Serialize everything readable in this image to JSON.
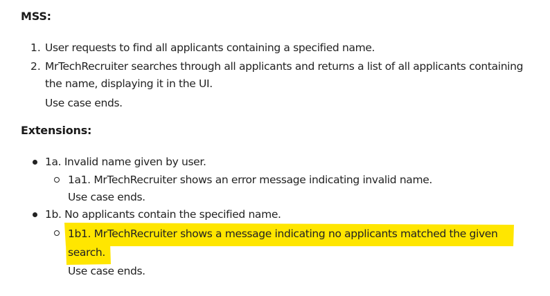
{
  "mss": {
    "heading": "MSS:",
    "steps": [
      {
        "number": "1.",
        "text": "User requests to find all applicants containing a specified name."
      },
      {
        "number": "2.",
        "line1": "MrTechRecruiter searches through all applicants and returns a list of all applicants containing",
        "line2": "the name, displaying it in the UI.",
        "end": "Use case ends."
      }
    ]
  },
  "extensions": {
    "heading": "Extensions:",
    "items": [
      {
        "text": "1a. Invalid name given by user.",
        "sub": {
          "text": "1a1. MrTechRecruiter shows an error message indicating invalid name.",
          "end": "Use case ends."
        }
      },
      {
        "text": "1b. No applicants contain the specified name.",
        "sub": {
          "line1": "1b1. MrTechRecruiter shows a message indicating no applicants matched the given",
          "line2": "search.",
          "end": "Use case ends."
        }
      }
    ]
  },
  "highlight": {
    "color": "#ffe600"
  }
}
